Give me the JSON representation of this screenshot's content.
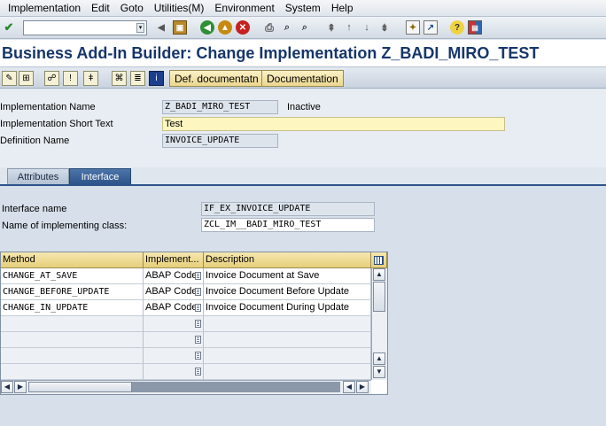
{
  "menu": [
    "Implementation",
    "Edit",
    "Goto",
    "Utilities(M)",
    "Environment",
    "System",
    "Help"
  ],
  "title": "Business Add-In Builder: Change Implementation Z_BADI_MIRO_TEST",
  "app_toolbar": {
    "btn_doc_def": "Def. documentatn",
    "btn_doc": "Documentation"
  },
  "form": {
    "impl_name_label": "Implementation Name",
    "impl_name_value": "Z_BADI_MIRO_TEST",
    "impl_status": "Inactive",
    "short_text_label": "Implementation Short Text",
    "short_text_value": "Test",
    "def_name_label": "Definition Name",
    "def_name_value": "INVOICE_UPDATE"
  },
  "tabs": {
    "attributes": "Attributes",
    "interface": "Interface"
  },
  "interface": {
    "name_label": "Interface name",
    "name_value": "IF_EX_INVOICE_UPDATE",
    "class_label": "Name of implementing class:",
    "class_value": "ZCL_IM__BADI_MIRO_TEST"
  },
  "table": {
    "headers": [
      "Method",
      "Implement...",
      "Description"
    ],
    "rows": [
      {
        "method": "CHANGE_AT_SAVE",
        "impl": "ABAP Code",
        "desc": "Invoice Document at Save"
      },
      {
        "method": "CHANGE_BEFORE_UPDATE",
        "impl": "ABAP Code",
        "desc": "Invoice Document Before Update"
      },
      {
        "method": "CHANGE_IN_UPDATE",
        "impl": "ABAP Code",
        "desc": "Invoice Document During Update"
      }
    ]
  },
  "colors": {
    "title": "#16366b",
    "tab_active": "#2d548a",
    "edit_field": "#fdf6c0"
  },
  "icons": [
    "enter-icon",
    "back-icon",
    "exit-icon",
    "cancel-icon",
    "save-icon",
    "print-icon",
    "find-icon",
    "help-icon"
  ]
}
